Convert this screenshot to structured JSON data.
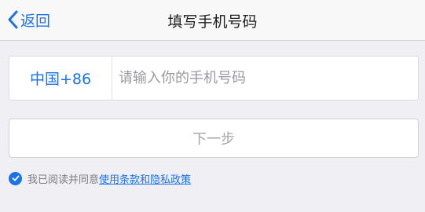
{
  "navbar": {
    "back_label": "返回",
    "title": "填写手机号码"
  },
  "phone_form": {
    "country_code": "中国+86",
    "phone_placeholder": "请输入你的手机号码",
    "phone_value": ""
  },
  "next_button": {
    "label": "下一步"
  },
  "agreement": {
    "checked": true,
    "text": "我已阅读并同意",
    "link_text": "使用条款和隐私政策"
  },
  "colors": {
    "accent": "#1a73e8",
    "background": "#efeff4",
    "navbar_bg": "#f8f8f8",
    "disabled_text": "#a6a6aa"
  },
  "icons": {
    "back": "chevron-left-icon",
    "checkbox": "check-circle-icon"
  }
}
